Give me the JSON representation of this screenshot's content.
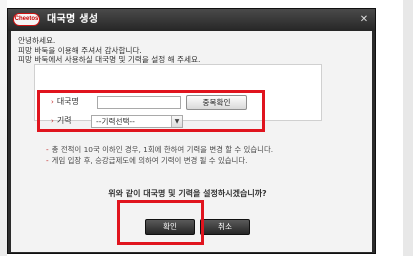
{
  "dialog": {
    "logo_text": "Cheetos",
    "title": "대국명 생성",
    "close_glyph": "✕"
  },
  "intro": {
    "line1": "안녕하세요.",
    "line2": "피망 바둑을 이용해 주셔서 감사합니다.",
    "line3": "피망 바둑에서 사용하실 대국명 및 기력을 설정 해 주세요."
  },
  "form": {
    "nickname_label": "대국명",
    "nickname_value": "",
    "duplicate_check_label": "중복확인",
    "rank_label": "기력",
    "rank_selected": "--기력선택--"
  },
  "notes": {
    "line1": "총 전적이 10국 이하인 경우, 1회에 한하여 기력을 변경 할 수 있습니다.",
    "line2": "게임 입장 후, 승강급제도에 의하여 기력이 변경 될 수 있습니다."
  },
  "confirm_question": "위와 같이 대국명 및 기력을 설정하시겠습니까?",
  "buttons": {
    "ok": "확인",
    "cancel": "취소"
  },
  "colors": {
    "highlight": "#e0141e",
    "bullet": "#c02020"
  }
}
